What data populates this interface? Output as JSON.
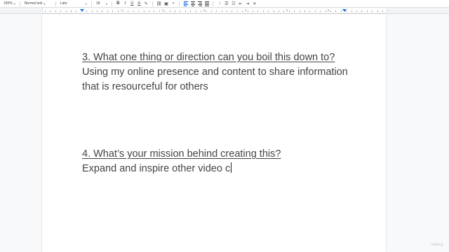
{
  "toolbar": {
    "zoom": "150%",
    "style": "Normal text",
    "font": "Lato",
    "font_size": "18",
    "bold": "B",
    "italic": "I",
    "underline": "U",
    "text_color": "A"
  },
  "ruler": {
    "numbers": [
      "1",
      "2",
      "3",
      "4",
      "5",
      "6"
    ]
  },
  "document": {
    "q3_heading": "3. What one thing or direction can you boil this down to?",
    "q3_line1": "Using my online presence and content to share information",
    "q3_line2": "that is resourceful for others",
    "q4_heading": "4. What’s your mission behind creating this?",
    "q4_answer": "Expand and inspire other video c"
  },
  "watermark": "udemy",
  "colors": {
    "accent": "#1a73e8",
    "text": "#444444"
  }
}
